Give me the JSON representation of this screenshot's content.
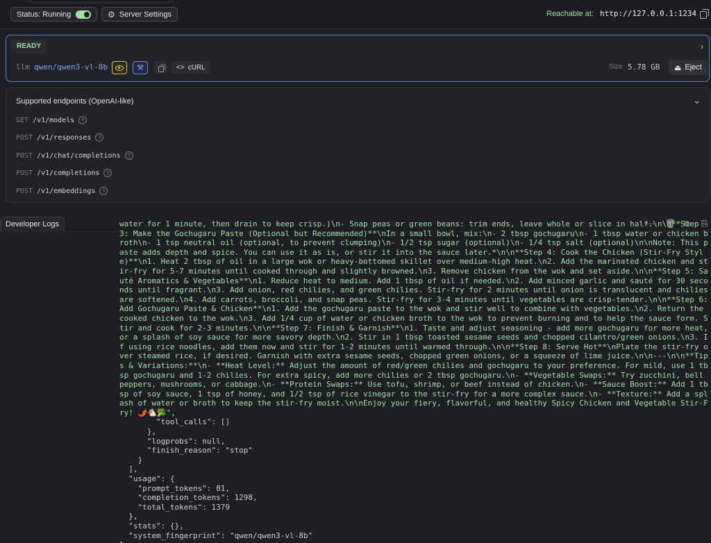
{
  "topbar": {
    "status_label": "Status: Running",
    "settings_label": "Server Settings",
    "reachable_label": "Reachable at:",
    "reachable_url": "http://127.0.0.1:1234"
  },
  "model": {
    "ready_label": "READY",
    "prefix": "llm",
    "model_id": "qwen/qwen3-vl-8b",
    "curl_label": "cURL",
    "size_label": "Size",
    "size_value": "5.78 GB",
    "eject_label": "Eject"
  },
  "endpoints": {
    "title": "Supported endpoints (OpenAI-like)",
    "items": [
      {
        "method": "GET",
        "path": "/v1/models"
      },
      {
        "method": "POST",
        "path": "/v1/responses"
      },
      {
        "method": "POST",
        "path": "/v1/chat/completions"
      },
      {
        "method": "POST",
        "path": "/v1/completions"
      },
      {
        "method": "POST",
        "path": "/v1/embeddings"
      }
    ]
  },
  "logs": {
    "tab_label": "Developer Logs",
    "content_text": "water for 1 minute, then drain to keep crisp.)\\n- Snap peas or green beans: trim ends, leave whole or slice in half.\\n\\n**Step 3: Make the Gochugaru Paste (Optional but Recommended)**\\nIn a small bowl, mix:\\n- 2 tbsp gochugaru\\n- 1 tbsp water or chicken broth\\n- 1 tsp neutral oil (optional, to prevent clumping)\\n- 1/2 tsp sugar (optional)\\n- 1/4 tsp salt (optional)\\n\\nNote: This paste adds depth and spice. You can use it as is, or stir it into the sauce later.*\\n\\n**Step 4: Cook the Chicken (Stir-Fry Style)**\\n1. Heat 2 tbsp of oil in a large wok or heavy-bottomed skillet over medium-high heat.\\n2. Add the marinated chicken and stir-fry for 5-7 minutes until cooked through and slightly browned.\\n3. Remove chicken from the wok and set aside.\\n\\n**Step 5: Sauté Aromatics & Vegetables**\\n1. Reduce heat to medium. Add 1 tbsp of oil if needed.\\n2. Add minced garlic and sauté for 30 seconds until fragrant.\\n3. Add onion, red chilies, and green chilies. Stir-fry for 2 minutes until onion is translucent and chilies are softened.\\n4. Add carrots, broccoli, and snap peas. Stir-fry for 3-4 minutes until vegetables are crisp-tender.\\n\\n**Step 6: Add Gochugaru Paste & Chicken**\\n1. Add the gochugaru paste to the wok and stir well to combine with vegetables.\\n2. Return the cooked chicken to the wok.\\n3. Add 1/4 cup of water or chicken broth to the wok to prevent burning and to help the sauce form. Stir and cook for 2-3 minutes.\\n\\n**Step 7: Finish & Garnish**\\n1. Taste and adjust seasoning - add more gochugaru for more heat, or a splash of soy sauce for more savory depth.\\n2. Stir in 1 tbsp toasted sesame seeds and chopped cilantro/green onions.\\n3. If using rice noodles, add them now and stir for 1-2 minutes until warmed through.\\n\\n**Step 8: Serve Hot**\\nPlate the stir-fry over steamed rice, if desired. Garnish with extra sesame seeds, chopped green onions, or a squeeze of lime juice.\\n\\n---\\n\\n**Tips & Variations:**\\n- **Heat Level:** Adjust the amount of red/green chilies and gochugaru to your preference. For mild, use 1 tbsp gochugaru and 1-2 chilies. For extra spicy, add more chilies or 2 tbsp gochugaru.\\n- **Vegetable Swaps:** Try zucchini, bell peppers, mushrooms, or cabbage.\\n- **Protein Swaps:** Use tofu, shrimp, or beef instead of chicken.\\n- **Sauce Boost:** Add 1 tbsp of soy sauce, 1 tsp of honey, and 1/2 tsp of rice vinegar to the stir-fry for a more complex sauce.\\n- **Texture:** Add a splash of water or broth to keep the stir-fry moist.\\n\\nEnjoy your fiery, flavorful, and healthy Spicy Chicken and Vegetable Stir-Fry! 🌶️🐔🥦\",",
    "json_tail": "        \"tool_calls\": []\n      },\n      \"logprobs\": null,\n      \"finish_reason\": \"stop\"\n    }\n  ],\n  \"usage\": {\n    \"prompt_tokens\": 81,\n    \"completion_tokens\": 1298,\n    \"total_tokens\": 1379\n  },\n  \"stats\": {},\n  \"system_fingerprint\": \"qwen/qwen3-vl-8b\"\n}"
  },
  "colors": {
    "accent_green": "#9fe0a8",
    "accent_blue": "#7aa8f0",
    "panel_border_active": "#4d7fd9",
    "vision_yellow": "#e0cc40"
  }
}
